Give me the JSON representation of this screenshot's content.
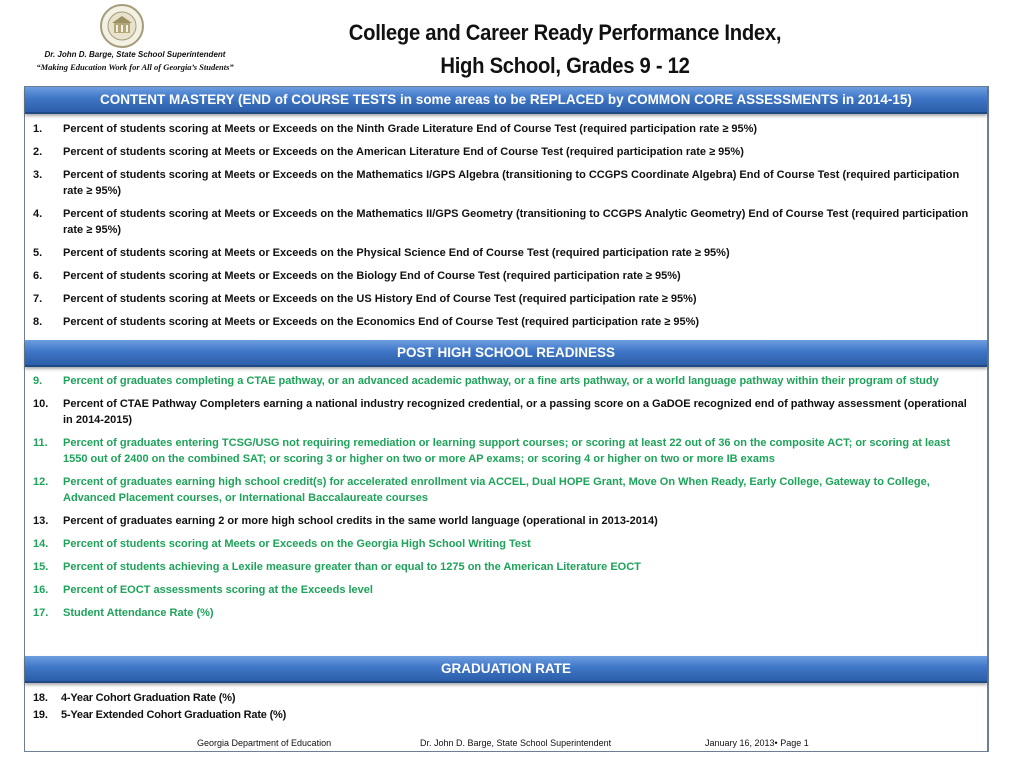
{
  "header": {
    "seal": "department-of-education-seal",
    "superintendent": "Dr. John D. Barge, State School Superintendent",
    "motto": "“Making Education Work for All of Georgia’s Students”",
    "title_line1": "College and Career Ready Performance Index,",
    "title_line2": "High School, Grades 9 - 12"
  },
  "colors": {
    "band": "#3f76c6",
    "green_text": "#1ea35a",
    "black_text": "#111111"
  },
  "sections": [
    {
      "heading": "CONTENT MASTERY (END of COURSE TESTS in some areas to be REPLACED by COMMON CORE ASSESSMENTS in 2014-15)",
      "items": [
        {
          "num": "1.",
          "text": "Percent of students scoring at Meets or Exceeds on the Ninth Grade Literature End of Course Test (required participation rate ≥ 95%)",
          "color": "black"
        },
        {
          "num": "2.",
          "text": "Percent of students scoring at Meets or Exceeds on the American Literature End of Course Test (required participation rate ≥ 95%)",
          "color": "black"
        },
        {
          "num": "3.",
          "text": "Percent of students scoring at Meets or Exceeds on the Mathematics I/GPS Algebra (transitioning to CCGPS Coordinate Algebra) End of Course Test (required participation rate ≥ 95%)",
          "color": "black"
        },
        {
          "num": "4.",
          "text": "Percent of students scoring at Meets or Exceeds on the Mathematics II/GPS Geometry (transitioning to CCGPS Analytic Geometry) End of Course Test (required participation rate ≥ 95%)",
          "color": "black"
        },
        {
          "num": "5.",
          "text": "Percent of students scoring at Meets or Exceeds on the Physical Science End of Course Test (required participation rate ≥ 95%)",
          "color": "black"
        },
        {
          "num": "6.",
          "text": "Percent of students scoring at Meets or Exceeds on the Biology End of Course Test (required participation rate ≥ 95%)",
          "color": "black"
        },
        {
          "num": "7.",
          "text": "Percent of students scoring at Meets or Exceeds on the US History End of Course Test (required participation rate ≥ 95%)",
          "color": "black"
        },
        {
          "num": "8.",
          "text": "Percent of students scoring at Meets or Exceeds on the Economics End of Course Test (required participation rate ≥ 95%)",
          "color": "black"
        }
      ]
    },
    {
      "heading": "POST HIGH SCHOOL READINESS",
      "items": [
        {
          "num": "9.",
          "text": "Percent of graduates completing a CTAE pathway, or an advanced academic pathway, or a fine arts pathway, or a world language pathway within their program of study",
          "color": "green"
        },
        {
          "num": "10.",
          "text": "Percent of  CTAE Pathway Completers earning a national industry recognized credential, or a passing score on a GaDOE recognized end of pathway assessment (operational in 2014-2015)",
          "color": "black"
        },
        {
          "num": "11.",
          "text": "Percent of graduates entering TCSG/USG not requiring remediation or learning support courses; or scoring at least 22 out of 36 on the composite ACT; or scoring at least 1550 out of 2400 on the combined SAT; or scoring 3 or higher on two or more AP exams; or scoring 4 or higher on two or more IB exams",
          "color": "green"
        },
        {
          "num": "12.",
          "text": "Percent of graduates earning high school credit(s) for accelerated enrollment via ACCEL, Dual HOPE Grant, Move On When Ready, Early College, Gateway to College, Advanced Placement courses, or International Baccalaureate courses",
          "color": "green"
        },
        {
          "num": "13.",
          "text": "Percent of graduates earning 2 or more high school credits in the same world language (operational in 2013-2014)",
          "color": "black"
        },
        {
          "num": "14.",
          "text": "Percent of students scoring at Meets or Exceeds on the Georgia High School Writing Test",
          "color": "green"
        },
        {
          "num": "15.",
          "text": "Percent of students achieving a Lexile measure greater than or equal to 1275 on the American Literature EOCT",
          "color": "green"
        },
        {
          "num": "16.",
          "text": "Percent of EOCT assessments scoring at the Exceeds level",
          "color": "green"
        },
        {
          "num": "17.",
          "text": "Student Attendance Rate (%)",
          "color": "green"
        }
      ]
    },
    {
      "heading": "GRADUATION RATE",
      "items": [
        {
          "num": "18.",
          "text": "4-Year Cohort Graduation Rate (%)",
          "color": "black"
        },
        {
          "num": "19.",
          "text": "5-Year Extended Cohort Graduation Rate (%)",
          "color": "black"
        }
      ]
    }
  ],
  "footer": {
    "org": "Georgia Department of Education",
    "superintendent": "Dr. John D. Barge, State School Superintendent",
    "date_page": "January 16, 2013• Page  1"
  }
}
